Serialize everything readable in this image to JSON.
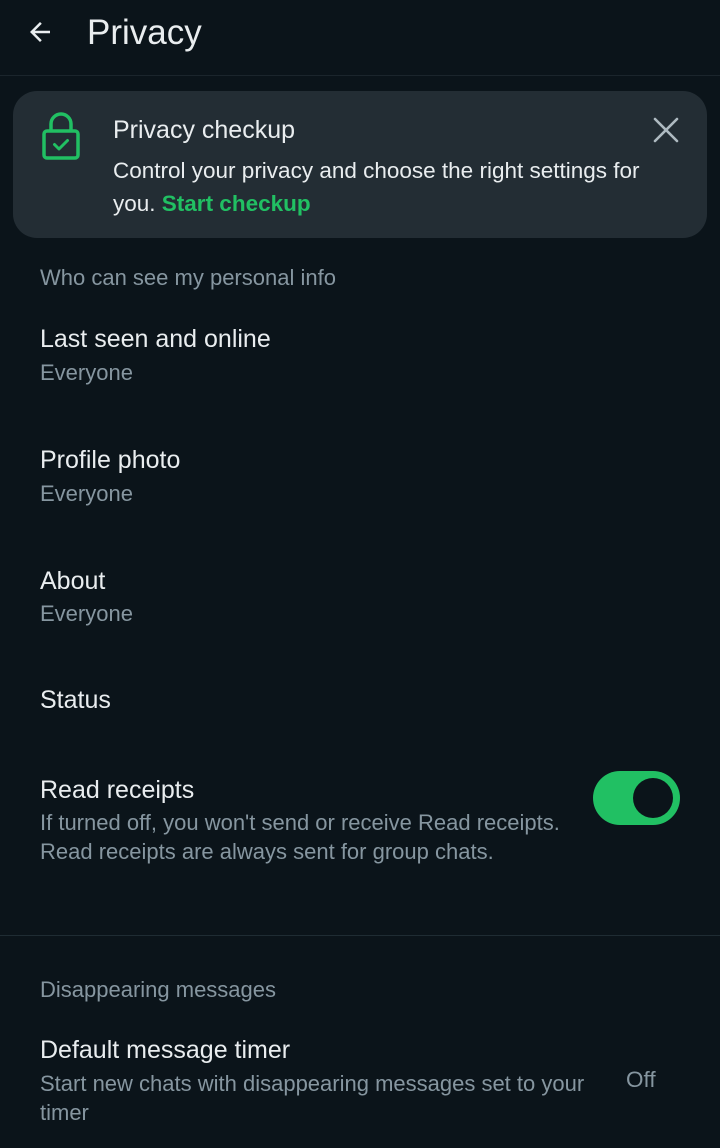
{
  "header": {
    "title": "Privacy",
    "back_icon": "arrow-left-icon"
  },
  "checkup_card": {
    "icon": "lock-icon",
    "title": "Privacy checkup",
    "body": "Control your privacy and choose the right settings for you.",
    "link_label": "Start checkup",
    "close_icon": "close-icon"
  },
  "personal_info": {
    "header": "Who can see my personal info",
    "items": [
      {
        "label": "Last seen and online",
        "value": "Everyone"
      },
      {
        "label": "Profile photo",
        "value": "Everyone"
      },
      {
        "label": "About",
        "value": "Everyone"
      },
      {
        "label": "Status"
      }
    ]
  },
  "read_receipts": {
    "label": "Read receipts",
    "description": "If turned off, you won't send or receive Read receipts. Read receipts are always sent for group chats.",
    "enabled": true
  },
  "disappearing": {
    "header": "Disappearing messages",
    "timer_label": "Default message timer",
    "timer_description": "Start new chats with disappearing messages set to your timer",
    "timer_value": "Off"
  },
  "colors": {
    "background": "#0b141a",
    "card": "#232d34",
    "accent": "#21c063",
    "text_primary": "#e9edef",
    "text_secondary": "#8696a0"
  }
}
